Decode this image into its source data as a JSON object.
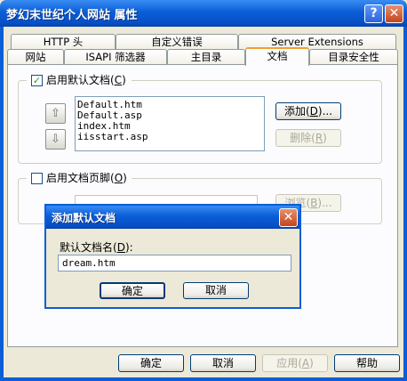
{
  "window": {
    "title": "梦幻末世纪个人网站 属性",
    "help_glyph": "?",
    "close_glyph": "✕"
  },
  "tabs": {
    "row_back": [
      "HTTP 头",
      "自定义错误",
      "Server Extensions"
    ],
    "row_front": [
      "网站",
      "ISAPI 筛选器",
      "主目录",
      "文档",
      "目录安全性"
    ],
    "active": "文档"
  },
  "default_doc": {
    "checkbox_label": "启用默认文档",
    "checkbox_key": "C",
    "checked": true,
    "items": [
      "Default.htm",
      "Default.asp",
      "index.htm",
      "iisstart.asp"
    ],
    "move_up_glyph": "⇧",
    "move_down_glyph": "⇩",
    "add_label": "添加",
    "add_key": "D",
    "add_suffix": "...",
    "remove_label": "删除",
    "remove_key": "R"
  },
  "footer_doc": {
    "checkbox_label": "启用文档页脚",
    "checkbox_key": "O",
    "checked": false,
    "browse_label": "浏览",
    "browse_key": "B",
    "browse_suffix": "..."
  },
  "dialog": {
    "title": "添加默认文档",
    "close_glyph": "✕",
    "field_label": "默认文档名",
    "field_key": "D",
    "field_value": "dream.htm",
    "ok_label": "确定",
    "cancel_label": "取消"
  },
  "bottom_buttons": {
    "ok": "确定",
    "cancel": "取消",
    "apply": "应用",
    "apply_key": "A",
    "help": "帮助"
  },
  "colors": {
    "titlebar": "#0a5ed6",
    "face": "#ece9d8",
    "panel": "#fcfcfe",
    "check_mark": "#21a121",
    "disabled_text": "#aca899"
  }
}
